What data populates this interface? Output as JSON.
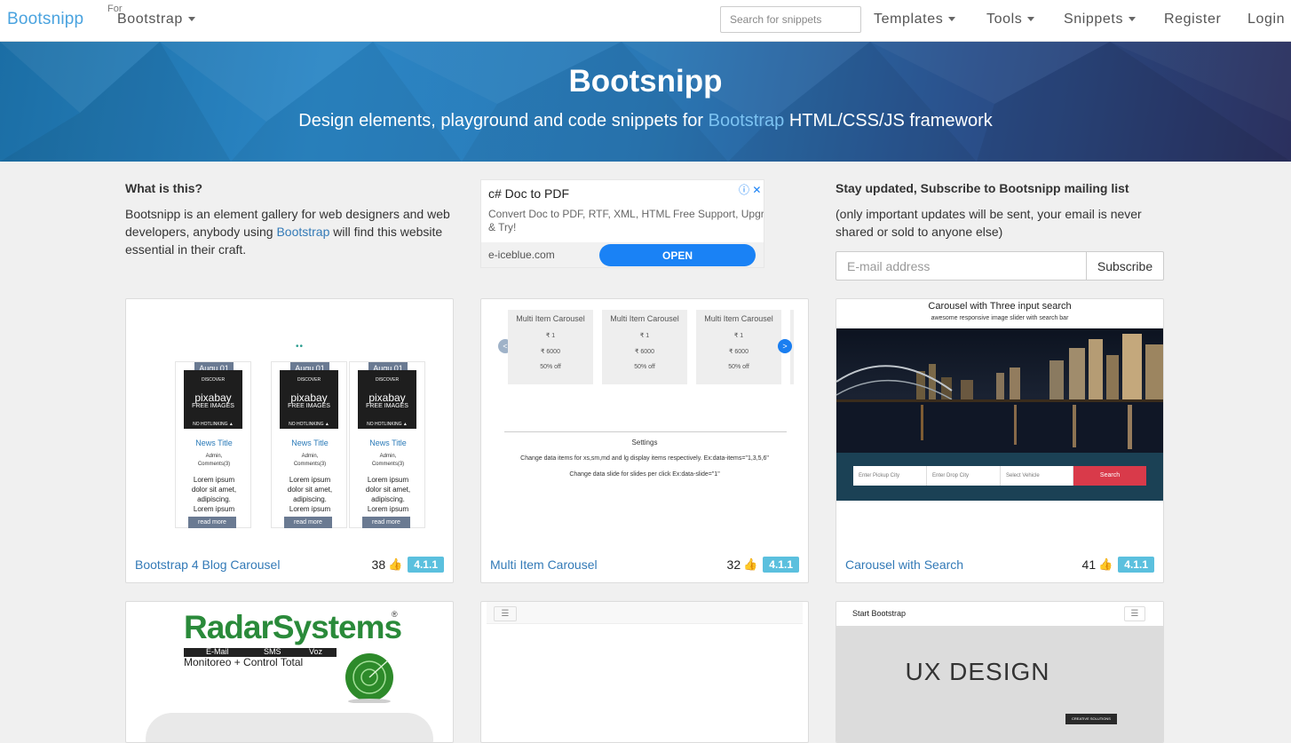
{
  "nav": {
    "brand": "Bootsnipp",
    "for_label": "For",
    "bootstrap_menu": "Bootstrap",
    "search_placeholder": "Search for snippets",
    "templates": "Templates",
    "tools": "Tools",
    "snippets": "Snippets",
    "register": "Register",
    "login": "Login"
  },
  "hero": {
    "title": "Bootsnipp",
    "subtitle_before": "Design elements, playground and code snippets for ",
    "subtitle_link": "Bootstrap",
    "subtitle_after": " HTML/CSS/JS framework"
  },
  "about": {
    "title": "What is this?",
    "text_before": "Bootsnipp is an element gallery for web designers and web developers, anybody using ",
    "text_link": "Bootstrap",
    "text_after": " will find this website essential in their craft."
  },
  "ad": {
    "title": "c# Doc to PDF",
    "text_line1": "Convert Doc to PDF, RTF, XML, HTML Free Support, Upgrade",
    "text_line2": "& Try!",
    "domain": "e-iceblue.com",
    "cta": "OPEN",
    "info_glyph": "ⓘ",
    "close_glyph": "✕"
  },
  "subscribe": {
    "title": "Stay updated, Subscribe to Bootsnipp mailing list",
    "text": "(only important updates will be sent, your email is never shared or sold to anyone else)",
    "placeholder": "E-mail address",
    "button": "Subscribe"
  },
  "cards": [
    {
      "title": "Bootstrap 4 Blog Carousel",
      "likes": "38",
      "version": "4.1.1",
      "preview": {
        "dots": "••",
        "date": "Augu 01",
        "img_top": "DISCOVER",
        "img_brand": "pixabay",
        "img_sub": "FREE IMAGES",
        "img_bottom": "NO HOTLINKING ▲",
        "news_title": "News Title",
        "meta1": "Admin,",
        "meta2": "Comments(3)",
        "lorem1": "Lorem ipsum",
        "lorem2": "dolor sit amet,",
        "lorem3": "adipiscing.",
        "lorem4": "Lorem ipsum",
        "button": "read more"
      }
    },
    {
      "title": "Multi Item Carousel",
      "likes": "32",
      "version": "4.1.1",
      "preview": {
        "item_title": "Multi Item Carousel",
        "price1": "₹ 1",
        "price2": "₹ 6000",
        "discount": "50% off",
        "prev": "<",
        "next": ">",
        "settings": "Settings",
        "line1": "Change data items for xs,sm,md and lg display items respectively. Ex:data-items=\"1,3,5,6\"",
        "line2": "Change data slide for slides per click Ex:data-slide=\"1\""
      }
    },
    {
      "title": "Carousel with Search",
      "likes": "41",
      "version": "4.1.1",
      "preview": {
        "title": "Carousel with Three input search",
        "subtitle": "awesome responsive image slider with search bar",
        "pickup": "Enter Pickup City",
        "drop": "Enter Drop City",
        "vehicle": "Select Vehicle",
        "search": "Search"
      }
    }
  ],
  "cards_row2": [
    {
      "logo_main": "RadarSystems",
      "logo_r": "®",
      "logo_tags": [
        "E-Mail",
        "SMS",
        "Voz"
      ],
      "logo_tagline": "Monitoreo + Control Total"
    },
    {
      "menu_glyph": "☰"
    },
    {
      "brand": "Start Bootstrap",
      "menu_glyph": "☰",
      "headline": "UX DESIGN",
      "tag": "CREATIVE SOLUTIONS"
    }
  ],
  "colors": {
    "brand": "#4aa3df",
    "link": "#337ab7",
    "badge": "#5bc0de",
    "ad_button": "#1a82f5"
  },
  "icons": {
    "thumbs_up": "thumbs-up-icon",
    "caret": "caret-down-icon",
    "menu": "hamburger-menu-icon"
  }
}
